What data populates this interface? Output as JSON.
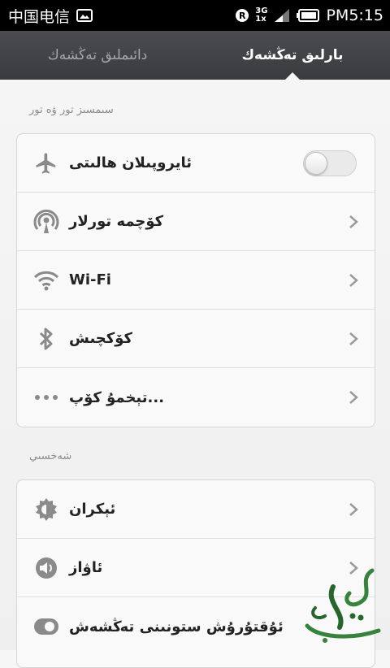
{
  "statusbar": {
    "carrier": "中国电信",
    "network_top": "3G",
    "network_bottom": "1x",
    "time": "PM5:15"
  },
  "tabs": [
    {
      "label": "بارلىق تەڭشەك",
      "active": true
    },
    {
      "label": "دائىملىق تەڭشەك",
      "active": false
    }
  ],
  "sections": [
    {
      "title": "سىمسىز تور ۋە تور",
      "items": [
        {
          "label": "ئايروپىلان ھالىتى",
          "icon": "airplane-icon",
          "control": "toggle",
          "toggle_on": false
        },
        {
          "label": "كۆچمە تورلار",
          "icon": "cellular-antenna-icon",
          "control": "chevron"
        },
        {
          "label": "Wi-Fi",
          "icon": "wifi-icon",
          "control": "chevron"
        },
        {
          "label": "كۆكچىش",
          "icon": "bluetooth-icon",
          "control": "chevron"
        },
        {
          "label": "تېخمۇ كۆپ...",
          "icon": "more-dots-icon",
          "control": "chevron"
        }
      ]
    },
    {
      "title": "شەخسىي",
      "items": [
        {
          "label": "ئېكران",
          "icon": "display-icon",
          "control": "chevron"
        },
        {
          "label": "ئاۋاز",
          "icon": "sound-icon",
          "control": "chevron"
        },
        {
          "label": "ئۇقتۇرۇش ستونىنى تەڭشەش",
          "icon": "notification-icon",
          "control": "chevron"
        }
      ]
    }
  ],
  "colors": {
    "statusbar_bg": "#000000",
    "tabbar_bg": "#3f4044",
    "active_tab_text": "#ffffff",
    "inactive_tab_text": "#a7a7a9",
    "icon_gray": "#8a8a8a"
  }
}
